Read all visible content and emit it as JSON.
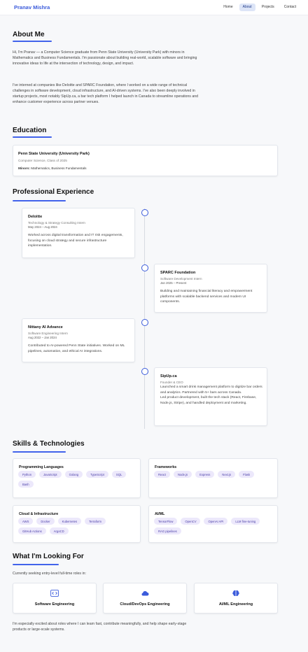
{
  "nav": {
    "brand": "Pranav Mishra",
    "links": [
      "Home",
      "About",
      "Projects",
      "Contact"
    ],
    "active": "About"
  },
  "about": {
    "heading": "About Me",
    "paragraphs": [
      "Hi, I'm Pranav — a Computer Science graduate from Penn State University (University Park) with minors in Mathematics and Business Fundamentals. I'm passionate about building real-world, scalable software and bringing innovative ideas to life at the intersection of technology, design, and impact.",
      "I've interned at companies like Deloitte and SPARC Foundation, where I worked on a wide range of technical challenges in software development, cloud infrastructure, and AI-driven systems. I've also been deeply involved in startup projects, most notably SipUp.ca, a bar tech platform I helped launch in Canada to streamline operations and enhance customer experience across partner venues."
    ]
  },
  "education": {
    "heading": "Education",
    "school": "Penn State University (University Park)",
    "degree": "Computer Science, Class of 2025",
    "minors_label": "Minors:",
    "minors": "Mathematics, Business Fundamentals"
  },
  "experience": {
    "heading": "Professional Experience",
    "items": [
      {
        "company": "Deloitte",
        "role": "Technology & Strategy Consulting Intern",
        "dates": "May 2024 – Aug 2024",
        "desc": "Worked across digital transformation and IT risk engagements, focusing on cloud strategy and secure infrastructure implementation."
      },
      {
        "company": "SPARC Foundation",
        "role": "Software Development Intern",
        "dates": "Jan 2025 – Present",
        "desc": "Building and maintaining financial literacy and empowerment platforms with scalable backend services and modern UI components."
      },
      {
        "company": "Nittany AI Advance",
        "role": "Software Engineering Intern",
        "dates": "Aug 2022 – Jan 2024",
        "desc": "Contributed to AI-powered Penn State initiatives. Worked on ML pipelines, automation, and ethical AI integrations."
      },
      {
        "company": "SipUp.ca",
        "role": "Founder & CEO",
        "desc": "Launched a smart drink management platform to digitize bar orders and analytics. Partnered with 5+ bars across Canada.",
        "desc2": "Led product development, built the tech stack (React, Firebase, Node.js, Stripe), and handled deployment and marketing."
      }
    ]
  },
  "skills": {
    "heading": "Skills & Technologies",
    "groups": [
      {
        "title": "Programming Languages",
        "items": [
          "Python",
          "JavaScript",
          "Golang",
          "TypeScript",
          "SQL",
          "Bash"
        ]
      },
      {
        "title": "Frameworks",
        "items": [
          "React",
          "Node.js",
          "Express",
          "Next.js",
          "Flask"
        ]
      },
      {
        "title": "Cloud & Infrastructure",
        "items": [
          "AWS",
          "Docker",
          "Kubernetes",
          "Terraform",
          "GitHub Actions",
          "ArgoCD"
        ]
      },
      {
        "title": "AI/ML",
        "items": [
          "TensorFlow",
          "OpenCV",
          "OpenAI API",
          "LLM fine-tuning",
          "RAG pipelines"
        ]
      }
    ]
  },
  "looking": {
    "heading": "What I'm Looking For",
    "intro": "Currently seeking entry-level full-time roles in:",
    "roles": [
      {
        "label": "Software Engineering",
        "icon": "code-icon"
      },
      {
        "label": "Cloud/DevOps Engineering",
        "icon": "cloud-icon"
      },
      {
        "label": "AI/ML Engineering",
        "icon": "brain-icon"
      }
    ],
    "outro": "I'm especially excited about roles where I can learn fast, contribute meaningfully, and help shape early-stage products or large-scale systems."
  },
  "colors": {
    "accent": "#3b5bdb",
    "chip_bg": "#ece8fb",
    "chip_text": "#4a3ea8",
    "page_bg": "#f7f8fa"
  }
}
